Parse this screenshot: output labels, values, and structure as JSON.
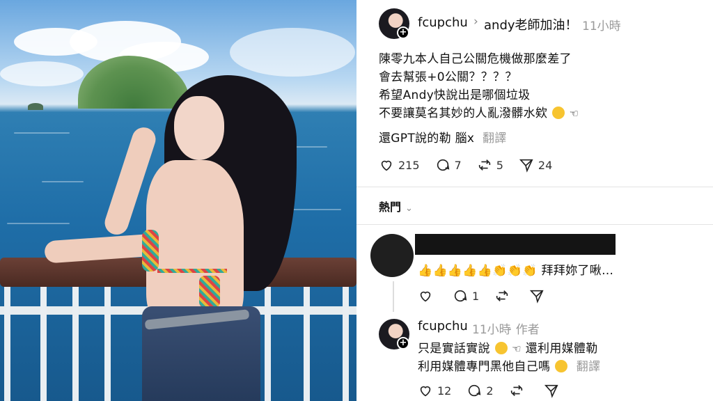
{
  "post": {
    "username": "fcupchu",
    "reply_to_arrow": "›",
    "reply_to": "andy老師加油！",
    "time": "11小時",
    "lines": [
      "陳零九本人自己公關危機做那麼差了",
      "會去幫張+0公關？？？？",
      "希望Andy快說出是哪個垃圾",
      "不要讓莫名其妙的人亂潑髒水欸"
    ],
    "line5": "還GPT說的勒 腦x",
    "translate": "翻譯",
    "likes": "215",
    "comments": "7",
    "reposts": "5",
    "shares": "24"
  },
  "sort": {
    "label": "熱門",
    "chevron": "⌄"
  },
  "reply1": {
    "text": "拜拜妳了啾…",
    "comments": "1"
  },
  "reply2": {
    "username": "fcupchu",
    "time": "11小時",
    "author_tag": "· 作者",
    "line1_a": "只是實話實說",
    "line1_b": "還利用媒體勒",
    "line2": "利用媒體專門黑他自己嗎",
    "translate": "翻譯",
    "likes": "12",
    "comments": "2"
  },
  "colors": {
    "text": "#111111",
    "muted": "#999999",
    "divider": "#e3e3e3"
  },
  "icons": [
    "heart-icon",
    "comment-icon",
    "repost-icon",
    "share-icon",
    "plus-icon",
    "point-left-emoji",
    "surprised-emoji",
    "thumbs-up-emoji",
    "clap-emoji",
    "sweat-smile-emoji"
  ]
}
